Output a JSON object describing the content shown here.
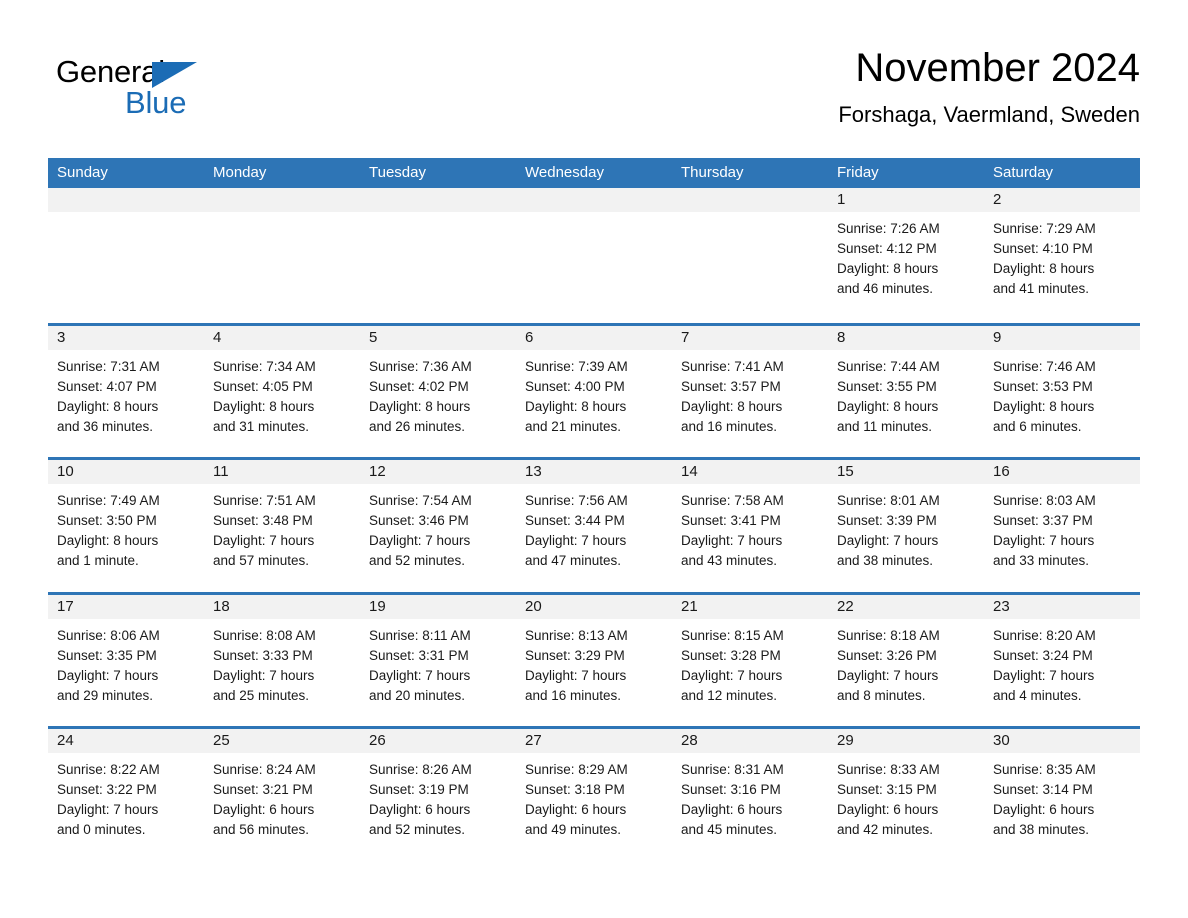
{
  "logo": {
    "word1": "General",
    "word2": "Blue",
    "triangle_color": "#1b6cb5",
    "text_color": "#000000"
  },
  "header": {
    "title": "November 2024",
    "subtitle": "Forshaga, Vaermland, Sweden"
  },
  "theme": {
    "accent": "#2e75b6",
    "band": "#f2f2f2",
    "text": "#1a1a1a",
    "header_text": "#ffffff"
  },
  "weekdays": [
    "Sunday",
    "Monday",
    "Tuesday",
    "Wednesday",
    "Thursday",
    "Friday",
    "Saturday"
  ],
  "weeks": [
    [
      {
        "day": "",
        "empty": true
      },
      {
        "day": "",
        "empty": true
      },
      {
        "day": "",
        "empty": true
      },
      {
        "day": "",
        "empty": true
      },
      {
        "day": "",
        "empty": true
      },
      {
        "day": "1",
        "sunrise": "Sunrise: 7:26 AM",
        "sunset": "Sunset: 4:12 PM",
        "daylight1": "Daylight: 8 hours",
        "daylight2": "and 46 minutes."
      },
      {
        "day": "2",
        "sunrise": "Sunrise: 7:29 AM",
        "sunset": "Sunset: 4:10 PM",
        "daylight1": "Daylight: 8 hours",
        "daylight2": "and 41 minutes."
      }
    ],
    [
      {
        "day": "3",
        "sunrise": "Sunrise: 7:31 AM",
        "sunset": "Sunset: 4:07 PM",
        "daylight1": "Daylight: 8 hours",
        "daylight2": "and 36 minutes."
      },
      {
        "day": "4",
        "sunrise": "Sunrise: 7:34 AM",
        "sunset": "Sunset: 4:05 PM",
        "daylight1": "Daylight: 8 hours",
        "daylight2": "and 31 minutes."
      },
      {
        "day": "5",
        "sunrise": "Sunrise: 7:36 AM",
        "sunset": "Sunset: 4:02 PM",
        "daylight1": "Daylight: 8 hours",
        "daylight2": "and 26 minutes."
      },
      {
        "day": "6",
        "sunrise": "Sunrise: 7:39 AM",
        "sunset": "Sunset: 4:00 PM",
        "daylight1": "Daylight: 8 hours",
        "daylight2": "and 21 minutes."
      },
      {
        "day": "7",
        "sunrise": "Sunrise: 7:41 AM",
        "sunset": "Sunset: 3:57 PM",
        "daylight1": "Daylight: 8 hours",
        "daylight2": "and 16 minutes."
      },
      {
        "day": "8",
        "sunrise": "Sunrise: 7:44 AM",
        "sunset": "Sunset: 3:55 PM",
        "daylight1": "Daylight: 8 hours",
        "daylight2": "and 11 minutes."
      },
      {
        "day": "9",
        "sunrise": "Sunrise: 7:46 AM",
        "sunset": "Sunset: 3:53 PM",
        "daylight1": "Daylight: 8 hours",
        "daylight2": "and 6 minutes."
      }
    ],
    [
      {
        "day": "10",
        "sunrise": "Sunrise: 7:49 AM",
        "sunset": "Sunset: 3:50 PM",
        "daylight1": "Daylight: 8 hours",
        "daylight2": "and 1 minute."
      },
      {
        "day": "11",
        "sunrise": "Sunrise: 7:51 AM",
        "sunset": "Sunset: 3:48 PM",
        "daylight1": "Daylight: 7 hours",
        "daylight2": "and 57 minutes."
      },
      {
        "day": "12",
        "sunrise": "Sunrise: 7:54 AM",
        "sunset": "Sunset: 3:46 PM",
        "daylight1": "Daylight: 7 hours",
        "daylight2": "and 52 minutes."
      },
      {
        "day": "13",
        "sunrise": "Sunrise: 7:56 AM",
        "sunset": "Sunset: 3:44 PM",
        "daylight1": "Daylight: 7 hours",
        "daylight2": "and 47 minutes."
      },
      {
        "day": "14",
        "sunrise": "Sunrise: 7:58 AM",
        "sunset": "Sunset: 3:41 PM",
        "daylight1": "Daylight: 7 hours",
        "daylight2": "and 43 minutes."
      },
      {
        "day": "15",
        "sunrise": "Sunrise: 8:01 AM",
        "sunset": "Sunset: 3:39 PM",
        "daylight1": "Daylight: 7 hours",
        "daylight2": "and 38 minutes."
      },
      {
        "day": "16",
        "sunrise": "Sunrise: 8:03 AM",
        "sunset": "Sunset: 3:37 PM",
        "daylight1": "Daylight: 7 hours",
        "daylight2": "and 33 minutes."
      }
    ],
    [
      {
        "day": "17",
        "sunrise": "Sunrise: 8:06 AM",
        "sunset": "Sunset: 3:35 PM",
        "daylight1": "Daylight: 7 hours",
        "daylight2": "and 29 minutes."
      },
      {
        "day": "18",
        "sunrise": "Sunrise: 8:08 AM",
        "sunset": "Sunset: 3:33 PM",
        "daylight1": "Daylight: 7 hours",
        "daylight2": "and 25 minutes."
      },
      {
        "day": "19",
        "sunrise": "Sunrise: 8:11 AM",
        "sunset": "Sunset: 3:31 PM",
        "daylight1": "Daylight: 7 hours",
        "daylight2": "and 20 minutes."
      },
      {
        "day": "20",
        "sunrise": "Sunrise: 8:13 AM",
        "sunset": "Sunset: 3:29 PM",
        "daylight1": "Daylight: 7 hours",
        "daylight2": "and 16 minutes."
      },
      {
        "day": "21",
        "sunrise": "Sunrise: 8:15 AM",
        "sunset": "Sunset: 3:28 PM",
        "daylight1": "Daylight: 7 hours",
        "daylight2": "and 12 minutes."
      },
      {
        "day": "22",
        "sunrise": "Sunrise: 8:18 AM",
        "sunset": "Sunset: 3:26 PM",
        "daylight1": "Daylight: 7 hours",
        "daylight2": "and 8 minutes."
      },
      {
        "day": "23",
        "sunrise": "Sunrise: 8:20 AM",
        "sunset": "Sunset: 3:24 PM",
        "daylight1": "Daylight: 7 hours",
        "daylight2": "and 4 minutes."
      }
    ],
    [
      {
        "day": "24",
        "sunrise": "Sunrise: 8:22 AM",
        "sunset": "Sunset: 3:22 PM",
        "daylight1": "Daylight: 7 hours",
        "daylight2": "and 0 minutes."
      },
      {
        "day": "25",
        "sunrise": "Sunrise: 8:24 AM",
        "sunset": "Sunset: 3:21 PM",
        "daylight1": "Daylight: 6 hours",
        "daylight2": "and 56 minutes."
      },
      {
        "day": "26",
        "sunrise": "Sunrise: 8:26 AM",
        "sunset": "Sunset: 3:19 PM",
        "daylight1": "Daylight: 6 hours",
        "daylight2": "and 52 minutes."
      },
      {
        "day": "27",
        "sunrise": "Sunrise: 8:29 AM",
        "sunset": "Sunset: 3:18 PM",
        "daylight1": "Daylight: 6 hours",
        "daylight2": "and 49 minutes."
      },
      {
        "day": "28",
        "sunrise": "Sunrise: 8:31 AM",
        "sunset": "Sunset: 3:16 PM",
        "daylight1": "Daylight: 6 hours",
        "daylight2": "and 45 minutes."
      },
      {
        "day": "29",
        "sunrise": "Sunrise: 8:33 AM",
        "sunset": "Sunset: 3:15 PM",
        "daylight1": "Daylight: 6 hours",
        "daylight2": "and 42 minutes."
      },
      {
        "day": "30",
        "sunrise": "Sunrise: 8:35 AM",
        "sunset": "Sunset: 3:14 PM",
        "daylight1": "Daylight: 6 hours",
        "daylight2": "and 38 minutes."
      }
    ]
  ]
}
